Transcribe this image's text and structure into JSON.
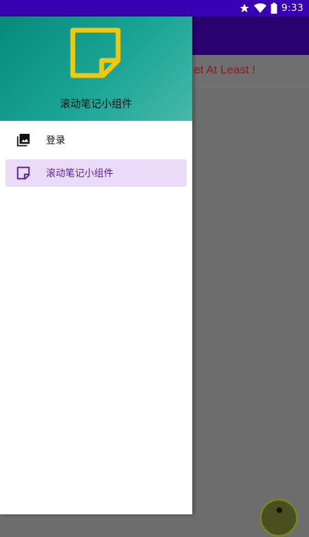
{
  "status_bar": {
    "time": "9:33",
    "icons": [
      "star-icon",
      "wifi-icon",
      "battery-icon"
    ]
  },
  "app": {
    "row_text": "et At Least !",
    "toolbar_color": "#2b006f",
    "row_text_color": "#8c1c1c"
  },
  "drawer": {
    "header": {
      "logo_icon": "sticky-note-icon",
      "logo_color": "#f2c80f",
      "title": "滚动笔记小组件"
    },
    "items": [
      {
        "label": "登录",
        "icon": "photo-library-icon",
        "active": false
      },
      {
        "label": "滚动笔记小组件",
        "icon": "sticky-note-outline-icon",
        "active": true
      }
    ],
    "active_color": "#5a1fa6",
    "active_bg": "#eadcf8"
  }
}
